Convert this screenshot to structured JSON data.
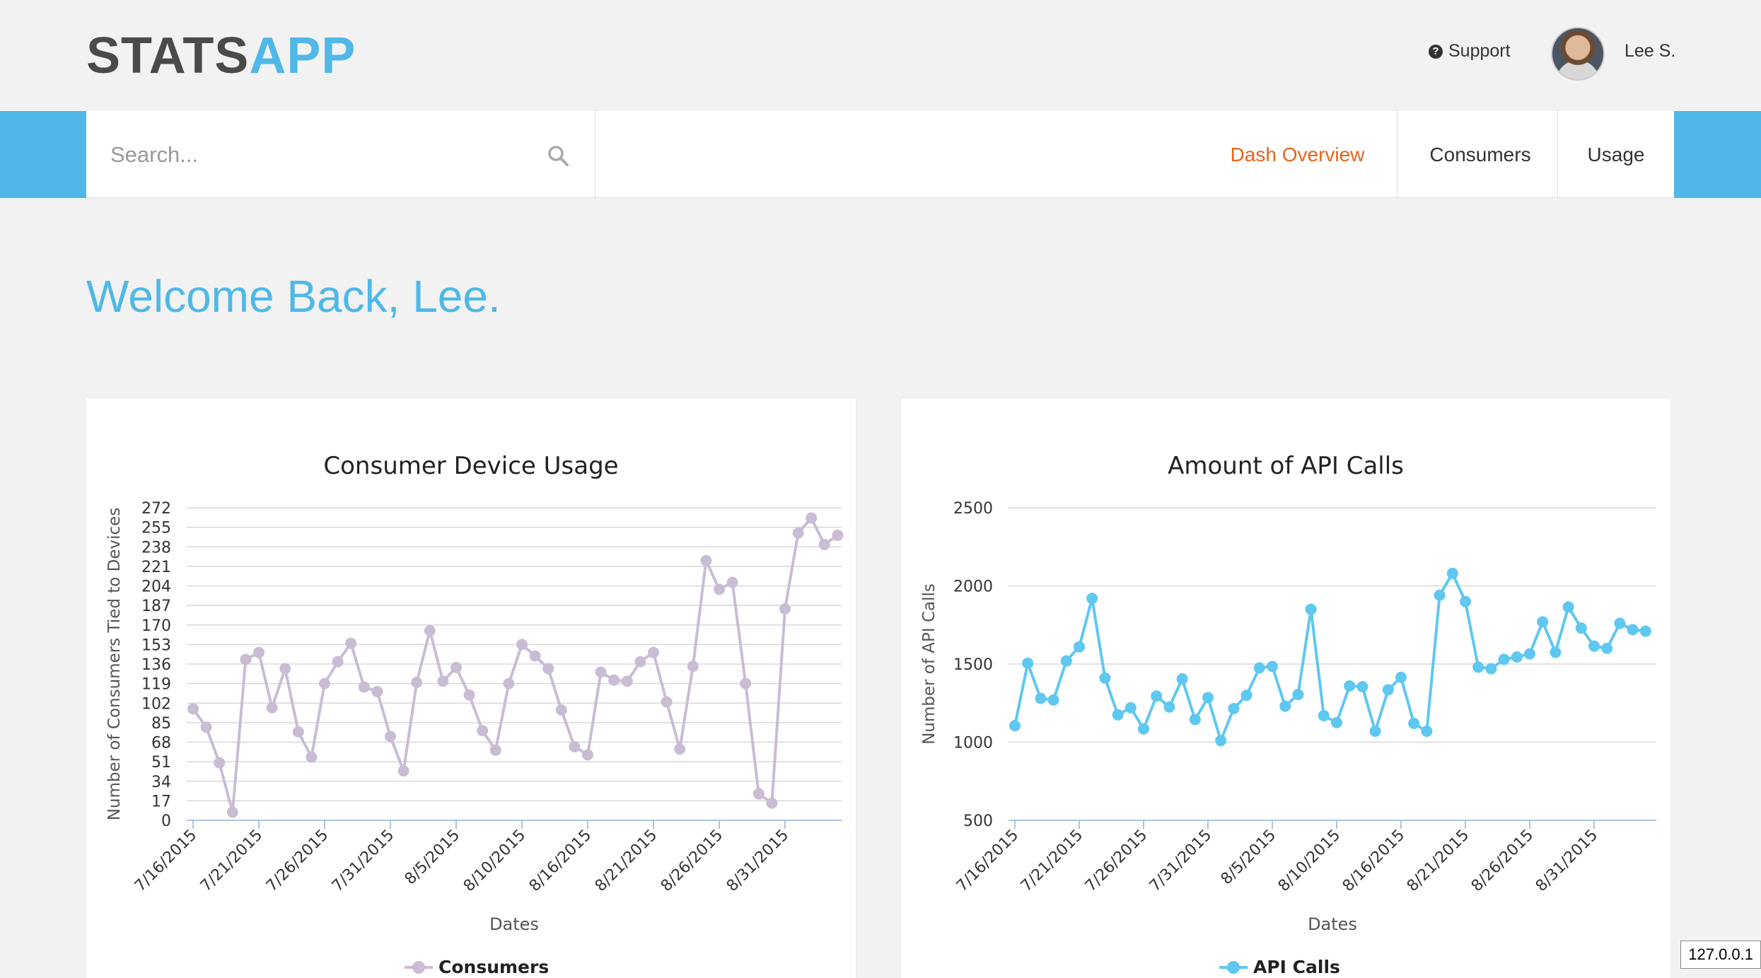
{
  "header": {
    "logo_part1": "STATS",
    "logo_part2": "APP",
    "support_label": "Support",
    "user_name": "Lee S."
  },
  "nav": {
    "search_placeholder": "Search...",
    "items": [
      {
        "label": "Dash Overview",
        "active": true
      },
      {
        "label": "Consumers",
        "active": false
      },
      {
        "label": "Usage",
        "active": false
      }
    ]
  },
  "welcome": "Welcome Back, Lee.",
  "status_ip": "127.0.0.1",
  "charts": [
    {
      "title": "Consumer Device Usage",
      "ylabel": "Number of Consumers Tied to Devices",
      "xlabel": "Dates",
      "legend": "Consumers"
    },
    {
      "title": "Amount of API Calls",
      "ylabel": "Number of API Calls",
      "xlabel": "Dates",
      "legend": "API Calls"
    }
  ],
  "chart_data": [
    {
      "type": "line",
      "title": "Consumer Device Usage",
      "xlabel": "Dates",
      "ylabel": "Number of Consumers Tied to Devices",
      "ylim": [
        0,
        272
      ],
      "yticks": [
        0,
        17,
        34,
        51,
        68,
        85,
        102,
        119,
        136,
        153,
        170,
        187,
        204,
        221,
        238,
        255,
        272
      ],
      "xtick_labels": [
        "7/16/2015",
        "7/21/2015",
        "7/26/2015",
        "7/31/2015",
        "8/5/2015",
        "8/10/2015",
        "8/16/2015",
        "8/21/2015",
        "8/26/2015",
        "8/31/2015"
      ],
      "color": "#c9bdd4",
      "legend_position": "bottom",
      "series": [
        {
          "name": "Consumers",
          "values": [
            97,
            81,
            50,
            7,
            140,
            146,
            98,
            132,
            77,
            55,
            119,
            138,
            154,
            116,
            112,
            73,
            43,
            120,
            165,
            121,
            133,
            109,
            78,
            61,
            119,
            153,
            143,
            132,
            96,
            64,
            57,
            129,
            122,
            121,
            138,
            146,
            103,
            62,
            134,
            226,
            201,
            207,
            119,
            23,
            15,
            184,
            250,
            263,
            240,
            248
          ]
        }
      ]
    },
    {
      "type": "line",
      "title": "Amount of API Calls",
      "xlabel": "Dates",
      "ylabel": "Number of API Calls",
      "ylim": [
        500,
        2500
      ],
      "yticks": [
        500,
        1000,
        1500,
        2000,
        2500
      ],
      "xtick_labels": [
        "7/16/2015",
        "7/21/2015",
        "7/26/2015",
        "7/31/2015",
        "8/5/2015",
        "8/10/2015",
        "8/16/2015",
        "8/21/2015",
        "8/26/2015",
        "8/31/2015"
      ],
      "color": "#5fc8f0",
      "legend_position": "bottom",
      "series": [
        {
          "name": "API Calls",
          "values": [
            1105,
            1505,
            1280,
            1270,
            1520,
            1610,
            1920,
            1410,
            1175,
            1220,
            1085,
            1295,
            1225,
            1405,
            1145,
            1285,
            1010,
            1215,
            1300,
            1475,
            1485,
            1230,
            1305,
            1850,
            1170,
            1125,
            1360,
            1355,
            1070,
            1335,
            1415,
            1120,
            1070,
            1940,
            2080,
            1900,
            1480,
            1470,
            1530,
            1545,
            1565,
            1770,
            1575,
            1865,
            1730,
            1615,
            1600,
            1760,
            1720,
            1710
          ]
        }
      ]
    }
  ]
}
